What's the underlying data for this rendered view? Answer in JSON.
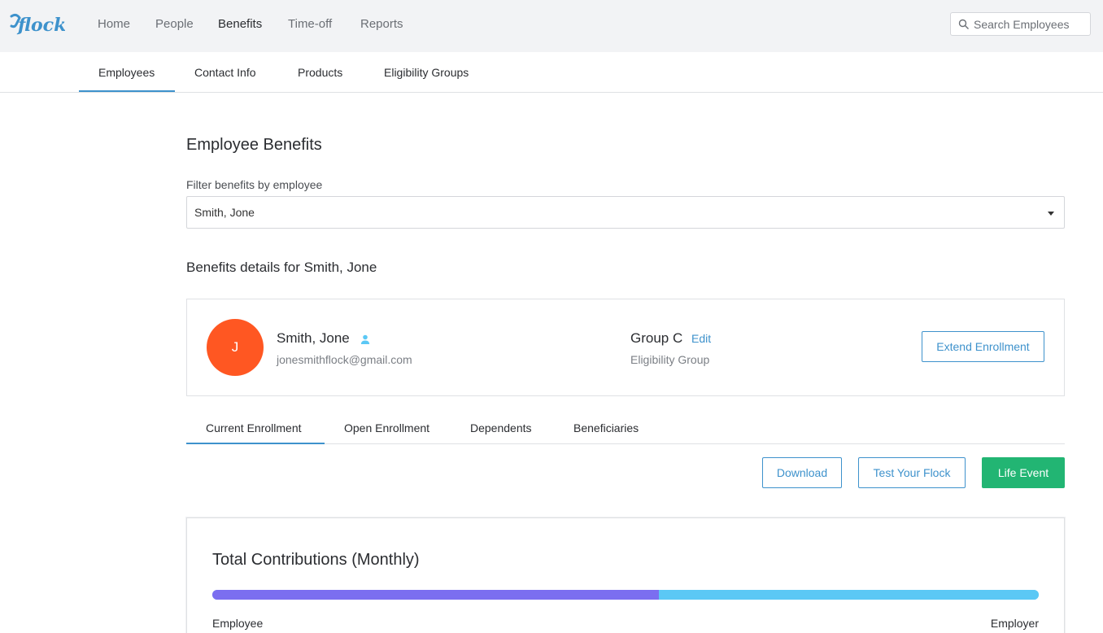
{
  "app": {
    "logo_text": "flock",
    "brand_color": "#3e92cc"
  },
  "topnav": {
    "items": [
      {
        "label": "Home"
      },
      {
        "label": "People"
      },
      {
        "label": "Benefits",
        "active": true
      },
      {
        "label": "Time-off"
      },
      {
        "label": "Reports"
      }
    ],
    "search": {
      "placeholder": "Search Employees",
      "value": "",
      "icon": "search-icon"
    }
  },
  "subnav": {
    "tabs": [
      {
        "label": "Employees",
        "active": true
      },
      {
        "label": "Contact Info"
      },
      {
        "label": "Products"
      },
      {
        "label": "Eligibility Groups"
      }
    ]
  },
  "main": {
    "title": "Employee Benefits",
    "filter": {
      "label": "Filter benefits by employee",
      "selected": "Smith, Jone"
    },
    "details_heading": "Benefits details for Smith, Jone",
    "employee_card": {
      "avatar_initial": "J",
      "avatar_color": "#ff5722",
      "name": "Smith, Jone",
      "name_icon": "person-icon",
      "email": "jonesmithflock@gmail.com",
      "group": "Group C",
      "group_edit_label": "Edit",
      "group_label": "Eligibility Group",
      "extend_button": "Extend Enrollment"
    },
    "tabs": [
      {
        "label": "Current Enrollment",
        "active": true
      },
      {
        "label": "Open Enrollment"
      },
      {
        "label": "Dependents"
      },
      {
        "label": "Beneficiaries"
      }
    ],
    "actions": {
      "download": "Download",
      "test_flock": "Test Your Flock",
      "life_event": "Life Event",
      "life_event_color": "#22b573"
    },
    "contributions": {
      "title": "Total Contributions (Monthly)",
      "employee_label": "Employee",
      "employer_label": "Employer",
      "employee_fraction": 0.54,
      "employer_fraction": 0.46,
      "employee_color": "#7b6ef0",
      "employer_color": "#5bc8f5"
    }
  }
}
